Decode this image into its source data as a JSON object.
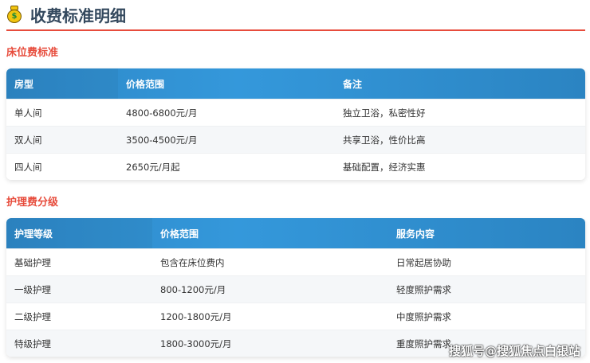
{
  "title": "收费标准明细",
  "icon": "money-bag-icon",
  "bed": {
    "title": "床位费标准",
    "headers": [
      "房型",
      "价格范围",
      "备注"
    ],
    "rows": [
      [
        "单人间",
        "4800-6800元/月",
        "独立卫浴，私密性好"
      ],
      [
        "双人间",
        "3500-4500元/月",
        "共享卫浴，性价比高"
      ],
      [
        "四人间",
        "2650元/月起",
        "基础配置，经济实惠"
      ]
    ]
  },
  "care": {
    "title": "护理费分级",
    "headers": [
      "护理等级",
      "价格范围",
      "服务内容"
    ],
    "rows": [
      [
        "基础护理",
        "包含在床位费内",
        "日常起居协助"
      ],
      [
        "一级护理",
        "800-1200元/月",
        "轻度照护需求"
      ],
      [
        "二级护理",
        "1200-1800元/月",
        "中度照护需求"
      ],
      [
        "特级护理",
        "1800-3000元/月",
        "重度照护需求"
      ]
    ]
  },
  "watermark": "搜狐号@搜狐焦点白银站"
}
